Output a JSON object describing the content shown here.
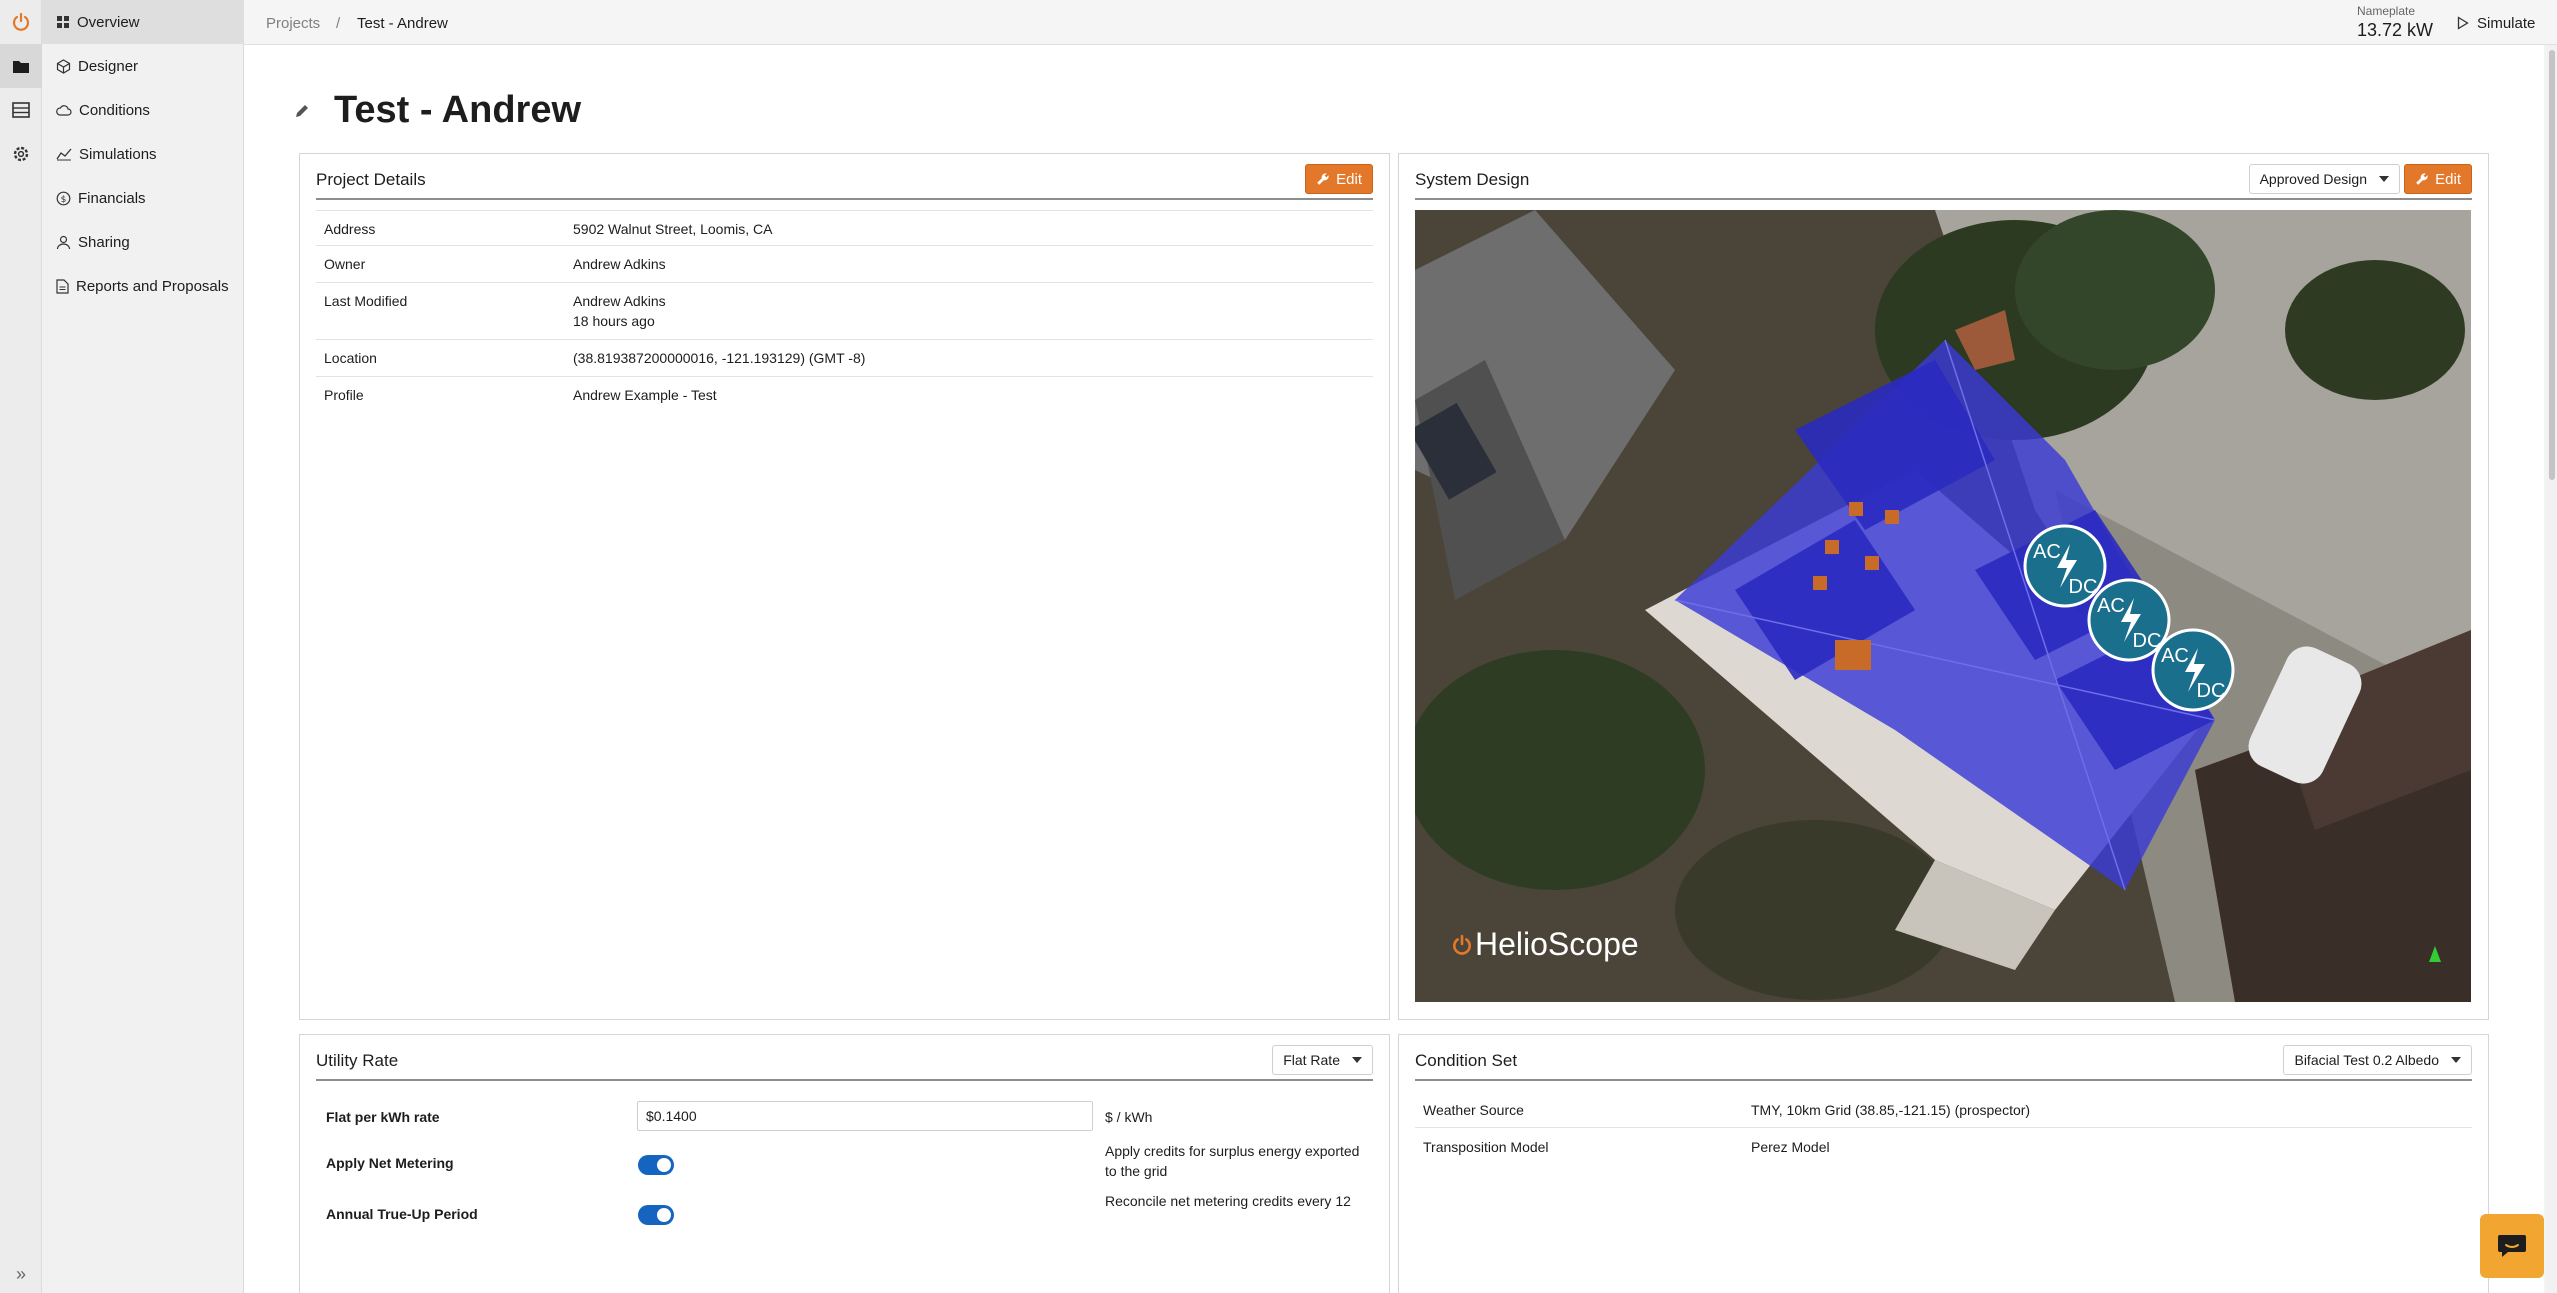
{
  "nav": {
    "items": [
      {
        "label": "Overview",
        "icon": "grid-icon"
      },
      {
        "label": "Designer",
        "icon": "cube-icon"
      },
      {
        "label": "Conditions",
        "icon": "cloud-icon"
      },
      {
        "label": "Simulations",
        "icon": "chart-icon"
      },
      {
        "label": "Financials",
        "icon": "dollar-icon"
      },
      {
        "label": "Sharing",
        "icon": "user-icon"
      },
      {
        "label": "Reports and Proposals",
        "icon": "document-icon"
      }
    ],
    "expand_glyph": "»"
  },
  "breadcrumb": {
    "root": "Projects",
    "separator": "/",
    "current": "Test - Andrew"
  },
  "topbar": {
    "nameplate_label": "Nameplate",
    "nameplate_value": "13.72 kW",
    "simulate_label": "Simulate"
  },
  "page": {
    "title": "Test - Andrew"
  },
  "project_details": {
    "title": "Project Details",
    "edit_label": "Edit",
    "rows": [
      {
        "label": "Address",
        "value": "5902 Walnut Street, Loomis, CA"
      },
      {
        "label": "Owner",
        "value": "Andrew Adkins"
      },
      {
        "label": "Last Modified",
        "value": "Andrew Adkins",
        "value2": "18 hours ago"
      },
      {
        "label": "Location",
        "value": "(38.819387200000016, -121.193129) (GMT -8)"
      },
      {
        "label": "Profile",
        "value": "Andrew Example - Test"
      }
    ]
  },
  "system_design": {
    "title": "System Design",
    "design_select": "Approved Design",
    "edit_label": "Edit",
    "logo_text": "HelioScope",
    "inverter_labels": {
      "top": "AC",
      "bottom": "DC"
    }
  },
  "utility_rate": {
    "title": "Utility Rate",
    "select": "Flat Rate",
    "rate_label": "Flat per kWh rate",
    "rate_value": "$0.1400",
    "rate_unit": "$ / kWh",
    "net_metering_label": "Apply Net Metering",
    "net_metering_help": "Apply credits for surplus energy exported to the grid",
    "trueup_label": "Annual True-Up Period",
    "trueup_help": "Reconcile net metering credits every 12"
  },
  "condition_set": {
    "title": "Condition Set",
    "select": "Bifacial Test 0.2 Albedo",
    "rows": [
      {
        "label": "Weather Source",
        "value": "TMY, 10km Grid (38.85,-121.15) (prospector)"
      },
      {
        "label": "Transposition Model",
        "value": "Perez Model"
      }
    ]
  },
  "colors": {
    "accent": "#e4782a",
    "toggle": "#1565c0",
    "chat": "#f2a531",
    "inverter": "#1a6f8c",
    "array": "#3b3bd6"
  }
}
